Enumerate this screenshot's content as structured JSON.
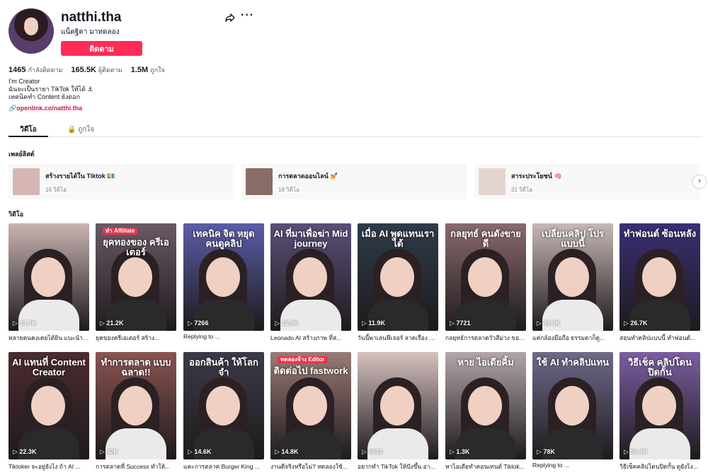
{
  "profile": {
    "username": "natthi.tha",
    "nickname": "แน็ตฐิตา มาทดลอง",
    "follow_label": "ติดตาม",
    "stats": [
      {
        "value": "1465",
        "label": "กำลังติดตาม"
      },
      {
        "value": "165.5K",
        "label": "ผู้ติดตาม"
      },
      {
        "value": "1.5M",
        "label": "ถูกใจ"
      }
    ],
    "bio": [
      "I'm Creator",
      "ฉันจะเป็นรายา TikTok ให้ได้ ⚓",
      "เทคนิคทำ Content ยังดอก"
    ],
    "link": "openlink.co/natthi.tha"
  },
  "tabs": [
    {
      "label": "วิดีโอ",
      "icon": "grid-icon"
    },
    {
      "label": "ถูกใจ",
      "icon": "lock-icon"
    }
  ],
  "playlists": {
    "title": "เพลย์ลิสต์",
    "items": [
      {
        "name": "สร้างรายได้ใน Tiktok 💵",
        "count": "16 วิดีโอ"
      },
      {
        "name": "การตลาดออนไลน์ 💅",
        "count": "18 วิดีโอ"
      },
      {
        "name": "สาระประโยชน์ 🧠",
        "count": "31 วิดีโอ"
      }
    ]
  },
  "videos": {
    "title": "วิดีโอ",
    "items": [
      {
        "views": "13.7K",
        "caption": "หลายคนคงเคยได้ยิน แนะนำคอร์ส...",
        "overlay": "",
        "bg": "#c9b4b2"
      },
      {
        "views": "21.2K",
        "caption": "ยุคของครีเอเตอร์ สร้าง...",
        "overlay": "ยุคทองของ ครีเอเตอร์",
        "tag": "ทำ Affiliate",
        "bg": "#6b5a66"
      },
      {
        "views": "7266",
        "caption": "Replying to ...",
        "overlay": "เทคนิค จิต หยุด คนดูคลิป",
        "bg": "#5a5ea8"
      },
      {
        "views": "16.5K",
        "caption": "Leonado AI สร้างภาพ ที่ส...",
        "overlay": "AI ที่มาเพื่อฆ่า Mid journey",
        "bg": "#5c4f7a"
      },
      {
        "views": "11.9K",
        "caption": "วันนี้พาเล่นฟีเจอร์ ลาดเรื่อง AI ...",
        "overlay": "เมื่อ AI พูดแทนเราได้",
        "bg": "#2e3c48"
      },
      {
        "views": "7721",
        "caption": "กลยุทธ์การตลาดวัวสีม่วง ของ...",
        "overlay": "กลยุทธ์ คนดังขายดี",
        "bg": "#8a6a6e"
      },
      {
        "views": "49.3K",
        "caption": "แค่กล้องมือถือ ธรรมดาก็ดู...",
        "overlay": "เปลี่ยนคลิป โปรแบบนี้",
        "bg": "#c7b9b6"
      },
      {
        "views": "26.7K",
        "caption": "สอนทำคลิปแบบนี้ ทำฟอนต์...",
        "overlay": "ทำฟอนต์ ซ้อนหลัง",
        "bg": "#3a2f74"
      },
      {
        "views": "22.3K",
        "caption": "Tiktoker จะอยู่ยังไง ถ้า AI ...",
        "overlay": "AI แทนที่ Content Creator",
        "bg": "#4c2b2f"
      },
      {
        "views": "32K",
        "caption": "การตลาดที่ Success ทำให้...",
        "overlay": "ทำการตลาด แบบฉลาด!!",
        "bg": "#8a5552"
      },
      {
        "views": "14.6K",
        "caption": "แคะการตลาด Burger King ...",
        "overlay": "ออกสินค้า ให้โลกจำ",
        "bg": "#3c3a48"
      },
      {
        "views": "14.8K",
        "caption": "งานดีจริงหรือไม่? ทดลองใช้...",
        "overlay": "ติดต่อไป fastwork",
        "tag": "ทดลองจ้าง Editor",
        "bg": "#9a7b77"
      },
      {
        "views": "6516",
        "caption": "อยากทำ TikTok ให้ปังขึ้น อา...",
        "overlay": "",
        "bg": "#d7c2c0"
      },
      {
        "views": "1.3K",
        "caption": "หาไอเดียทำคอนเทนต์ Tiktok...",
        "overlay": "หาย ไอเดียคิ้ม",
        "bg": "#b4a6a8"
      },
      {
        "views": "78K",
        "caption": "Replying to ...",
        "overlay": "ใช้ AI ทำคลิปแทน",
        "bg": "#6f6a8a"
      },
      {
        "views": "54.4K",
        "caption": "วิธีเช็คคลิปโดนปิดกั้น ดูยังไง...",
        "overlay": "วิธีเช็ค คลิปโดนปิดกั้น",
        "bg": "#7b5ea2"
      }
    ]
  },
  "icons": {
    "share": "share-icon",
    "more": "more-icon",
    "play": "play-icon",
    "next": "chevron-right-icon",
    "link": "link-icon"
  },
  "colors": {
    "accent": "#fe2c55",
    "link": "#c01f4a"
  }
}
